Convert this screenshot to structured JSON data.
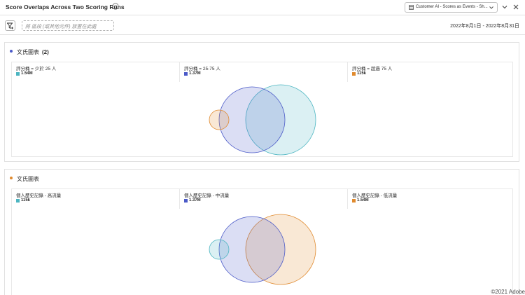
{
  "header": {
    "title": "Score Overlaps Across Two Scoring Runs",
    "info_icon": "info-circle-icon",
    "dataset_label": "Customer AI - Scores as Events - Sh...",
    "dataset_icon": "dataset-icon",
    "collapse_icon": "chevron-down-icon",
    "close_icon": "close-icon"
  },
  "filterbar": {
    "filter_icon": "filter-add-icon",
    "dropzone_placeholder": "將 區段 (或其他元件) 放置在此處",
    "date_range": "2022年8月1日 - 2022年8月31日"
  },
  "panels": [
    {
      "dot_color": "#4b5ac8",
      "title": "文氏圖表",
      "count": "(2)",
      "legend": [
        {
          "name": "評分桶 = 少於 25 人",
          "value": "1.54M",
          "color": "#4bb5c1"
        },
        {
          "name": "評分桶 = 25-75 人",
          "value": "1.37M",
          "color": "#4b5ac8"
        },
        {
          "name": "評分桶 = 超過 75 人",
          "value": "115k",
          "color": "#e08a2e"
        }
      ]
    },
    {
      "dot_color": "#e08a2e",
      "title": "文氏圖表",
      "count": "",
      "legend": [
        {
          "name": "個人歷史記錄 - 高流量",
          "value": "115k",
          "color": "#4bb5c1"
        },
        {
          "name": "個人歷史記錄 - 中流量",
          "value": "1.37M",
          "color": "#4b5ac8"
        },
        {
          "name": "個人歷史記錄 - 低流量",
          "value": "1.54M",
          "color": "#e08a2e"
        }
      ]
    }
  ],
  "colors": {
    "teal": "#4bb5c1",
    "indigo": "#4b5ac8",
    "orange": "#e08a2e"
  },
  "footer": {
    "copyright": "©2021 Adobe"
  }
}
